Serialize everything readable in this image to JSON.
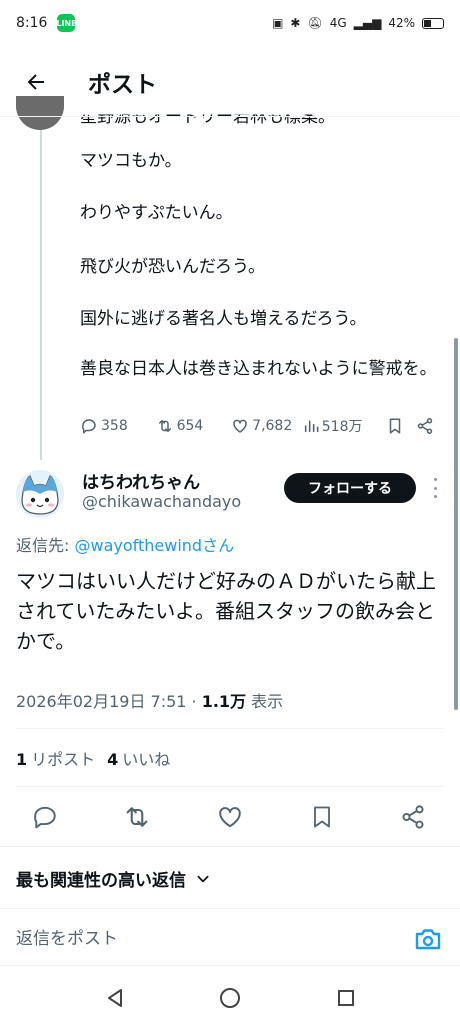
{
  "status_bar": {
    "time": "8:16",
    "app_badge": "LINE",
    "signal": "4G",
    "battery": "42%",
    "battery_level": 0.42
  },
  "header": {
    "title": "ポスト"
  },
  "parent_post": {
    "cut_line": "星野源もオードリー若林も標案。",
    "paragraphs": [
      "マツコもか。",
      "わりやすぷたいん。",
      "飛び火が恐いんだろう。",
      "国外に逃げる著名人も増えるだろう。",
      "善良な日本人は巻き込まれないように警戒を。"
    ],
    "metrics": {
      "replies": "358",
      "reposts": "654",
      "likes": "7,682",
      "views": "518万"
    }
  },
  "post": {
    "author_name": "はちわれちゃん",
    "handle": "@chikawachandayo",
    "follow_label": "フォローする",
    "reply_to_prefix": "返信先: ",
    "reply_to_mention": "@wayofthewindさん",
    "text": "マツコはいい人だけど好みのＡＤがいたら献上されていたみたいよ。番組スタッフの飲み会とかで。",
    "timestamp": "2026年02月19日 7:51 · ",
    "views_count": "1.1万",
    "views_label": " 表示",
    "reposts_count": "1",
    "reposts_label": "リポスト",
    "likes_count": "4",
    "likes_label": "いいね"
  },
  "replies_section": {
    "sort_label": "最も関連性の高い返信",
    "reply_placeholder": "返信をポスト"
  },
  "colors": {
    "accent": "#1d9bf0",
    "text": "#0f1419",
    "muted": "#536471",
    "follow_bg": "#0f1419"
  },
  "icons": [
    "back-arrow-icon",
    "reply-icon",
    "repost-icon",
    "like-icon",
    "views-icon",
    "bookmark-icon",
    "share-icon",
    "camera-icon",
    "chevron-down-icon"
  ]
}
